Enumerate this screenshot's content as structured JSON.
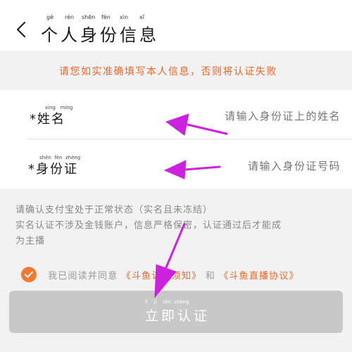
{
  "header": {
    "title": "个人身份信息",
    "title_pinyin": [
      "gè",
      "rén",
      "shēn",
      "fèn",
      "xìn",
      "xī"
    ],
    "back_icon": "chevron-left-icon"
  },
  "notice": {
    "text": "请您如实准确填写本人信息，否则将认证失败"
  },
  "form": {
    "name": {
      "label": "*姓名",
      "label_pinyin": [
        "xìng",
        "míng"
      ],
      "placeholder": "请输入身份证上的姓名"
    },
    "id_card": {
      "label": "*身份证",
      "label_pinyin": [
        "shēn",
        "fèn",
        "zhèng"
      ],
      "placeholder": "请输入身份证号码"
    }
  },
  "info": {
    "line1": "请确认支付宝处于正常状态（实名且未冻结）",
    "line2": "实名认证不涉及金钱账户，信息严格保密，认证通过后才能成",
    "line3": "为主播"
  },
  "agreement": {
    "prefix": "我已阅读并同意",
    "link1": "《斗鱼认证须知》",
    "middle": "和",
    "link2": "《斗鱼直播协议》",
    "checked": true,
    "check_color": "#f07a34"
  },
  "submit": {
    "label": "立即认证",
    "label_pinyin": [
      "lì",
      "jí",
      "rèn",
      "zhèng"
    ],
    "bg_color": "#c8c8c8"
  },
  "annotation": {
    "arrow_color": "#cc22dd"
  },
  "colors": {
    "accent": "#e8662a",
    "placeholder": "#bdbdbd",
    "background": "#f2f2f2"
  }
}
